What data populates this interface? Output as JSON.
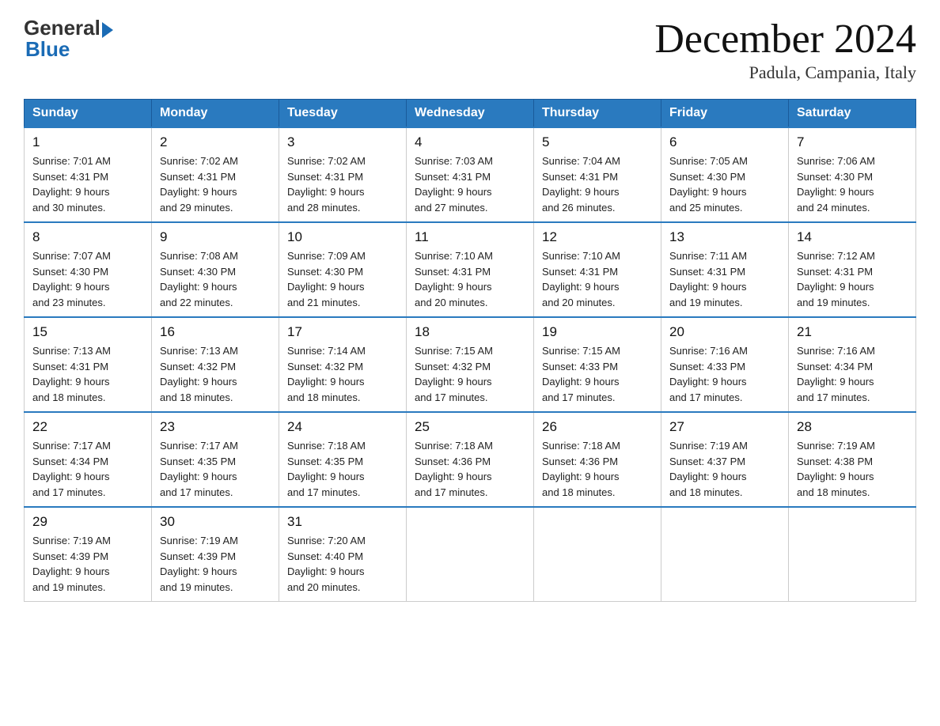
{
  "header": {
    "logo_general": "General",
    "logo_blue": "Blue",
    "month_title": "December 2024",
    "location": "Padula, Campania, Italy"
  },
  "days_of_week": [
    "Sunday",
    "Monday",
    "Tuesday",
    "Wednesday",
    "Thursday",
    "Friday",
    "Saturday"
  ],
  "weeks": [
    [
      {
        "day": "1",
        "sunrise": "7:01 AM",
        "sunset": "4:31 PM",
        "daylight": "9 hours and 30 minutes."
      },
      {
        "day": "2",
        "sunrise": "7:02 AM",
        "sunset": "4:31 PM",
        "daylight": "9 hours and 29 minutes."
      },
      {
        "day": "3",
        "sunrise": "7:02 AM",
        "sunset": "4:31 PM",
        "daylight": "9 hours and 28 minutes."
      },
      {
        "day": "4",
        "sunrise": "7:03 AM",
        "sunset": "4:31 PM",
        "daylight": "9 hours and 27 minutes."
      },
      {
        "day": "5",
        "sunrise": "7:04 AM",
        "sunset": "4:31 PM",
        "daylight": "9 hours and 26 minutes."
      },
      {
        "day": "6",
        "sunrise": "7:05 AM",
        "sunset": "4:30 PM",
        "daylight": "9 hours and 25 minutes."
      },
      {
        "day": "7",
        "sunrise": "7:06 AM",
        "sunset": "4:30 PM",
        "daylight": "9 hours and 24 minutes."
      }
    ],
    [
      {
        "day": "8",
        "sunrise": "7:07 AM",
        "sunset": "4:30 PM",
        "daylight": "9 hours and 23 minutes."
      },
      {
        "day": "9",
        "sunrise": "7:08 AM",
        "sunset": "4:30 PM",
        "daylight": "9 hours and 22 minutes."
      },
      {
        "day": "10",
        "sunrise": "7:09 AM",
        "sunset": "4:30 PM",
        "daylight": "9 hours and 21 minutes."
      },
      {
        "day": "11",
        "sunrise": "7:10 AM",
        "sunset": "4:31 PM",
        "daylight": "9 hours and 20 minutes."
      },
      {
        "day": "12",
        "sunrise": "7:10 AM",
        "sunset": "4:31 PM",
        "daylight": "9 hours and 20 minutes."
      },
      {
        "day": "13",
        "sunrise": "7:11 AM",
        "sunset": "4:31 PM",
        "daylight": "9 hours and 19 minutes."
      },
      {
        "day": "14",
        "sunrise": "7:12 AM",
        "sunset": "4:31 PM",
        "daylight": "9 hours and 19 minutes."
      }
    ],
    [
      {
        "day": "15",
        "sunrise": "7:13 AM",
        "sunset": "4:31 PM",
        "daylight": "9 hours and 18 minutes."
      },
      {
        "day": "16",
        "sunrise": "7:13 AM",
        "sunset": "4:32 PM",
        "daylight": "9 hours and 18 minutes."
      },
      {
        "day": "17",
        "sunrise": "7:14 AM",
        "sunset": "4:32 PM",
        "daylight": "9 hours and 18 minutes."
      },
      {
        "day": "18",
        "sunrise": "7:15 AM",
        "sunset": "4:32 PM",
        "daylight": "9 hours and 17 minutes."
      },
      {
        "day": "19",
        "sunrise": "7:15 AM",
        "sunset": "4:33 PM",
        "daylight": "9 hours and 17 minutes."
      },
      {
        "day": "20",
        "sunrise": "7:16 AM",
        "sunset": "4:33 PM",
        "daylight": "9 hours and 17 minutes."
      },
      {
        "day": "21",
        "sunrise": "7:16 AM",
        "sunset": "4:34 PM",
        "daylight": "9 hours and 17 minutes."
      }
    ],
    [
      {
        "day": "22",
        "sunrise": "7:17 AM",
        "sunset": "4:34 PM",
        "daylight": "9 hours and 17 minutes."
      },
      {
        "day": "23",
        "sunrise": "7:17 AM",
        "sunset": "4:35 PM",
        "daylight": "9 hours and 17 minutes."
      },
      {
        "day": "24",
        "sunrise": "7:18 AM",
        "sunset": "4:35 PM",
        "daylight": "9 hours and 17 minutes."
      },
      {
        "day": "25",
        "sunrise": "7:18 AM",
        "sunset": "4:36 PM",
        "daylight": "9 hours and 17 minutes."
      },
      {
        "day": "26",
        "sunrise": "7:18 AM",
        "sunset": "4:36 PM",
        "daylight": "9 hours and 18 minutes."
      },
      {
        "day": "27",
        "sunrise": "7:19 AM",
        "sunset": "4:37 PM",
        "daylight": "9 hours and 18 minutes."
      },
      {
        "day": "28",
        "sunrise": "7:19 AM",
        "sunset": "4:38 PM",
        "daylight": "9 hours and 18 minutes."
      }
    ],
    [
      {
        "day": "29",
        "sunrise": "7:19 AM",
        "sunset": "4:39 PM",
        "daylight": "9 hours and 19 minutes."
      },
      {
        "day": "30",
        "sunrise": "7:19 AM",
        "sunset": "4:39 PM",
        "daylight": "9 hours and 19 minutes."
      },
      {
        "day": "31",
        "sunrise": "7:20 AM",
        "sunset": "4:40 PM",
        "daylight": "9 hours and 20 minutes."
      },
      null,
      null,
      null,
      null
    ]
  ],
  "labels": {
    "sunrise": "Sunrise:",
    "sunset": "Sunset:",
    "daylight": "Daylight:"
  }
}
